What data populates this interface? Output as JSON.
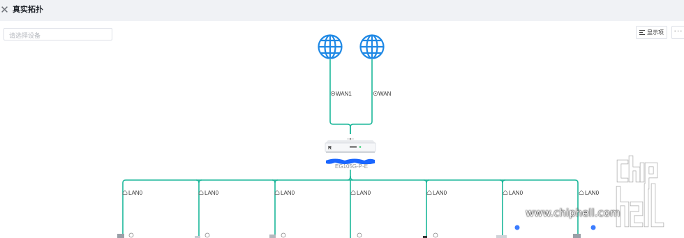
{
  "header": {
    "title": "真实拓扑",
    "close_icon": "close-icon"
  },
  "search": {
    "placeholder": "请选择设备",
    "value": ""
  },
  "toolbar": {
    "display_label": "显示项",
    "more_label": "···"
  },
  "topology": {
    "internet_nodes": [
      {
        "icon": "globe-icon"
      },
      {
        "icon": "globe-icon"
      }
    ],
    "wan_links": [
      {
        "label": "WAN1"
      },
      {
        "label": "WAN"
      }
    ],
    "router": {
      "logo": "R",
      "model": "EG105G-P-E"
    },
    "lan_links": [
      {
        "label": "LAN0"
      },
      {
        "label": "LAN0"
      },
      {
        "label": "LAN0"
      },
      {
        "label": "LAN0"
      },
      {
        "label": "LAN0"
      },
      {
        "label": "LAN0"
      },
      {
        "label": "LAN0"
      }
    ],
    "link_color": "#1cb79a",
    "globe_color": "#1e88e5"
  },
  "watermark": {
    "text": "www.chiphell.com",
    "logo_text": "chip hell"
  }
}
